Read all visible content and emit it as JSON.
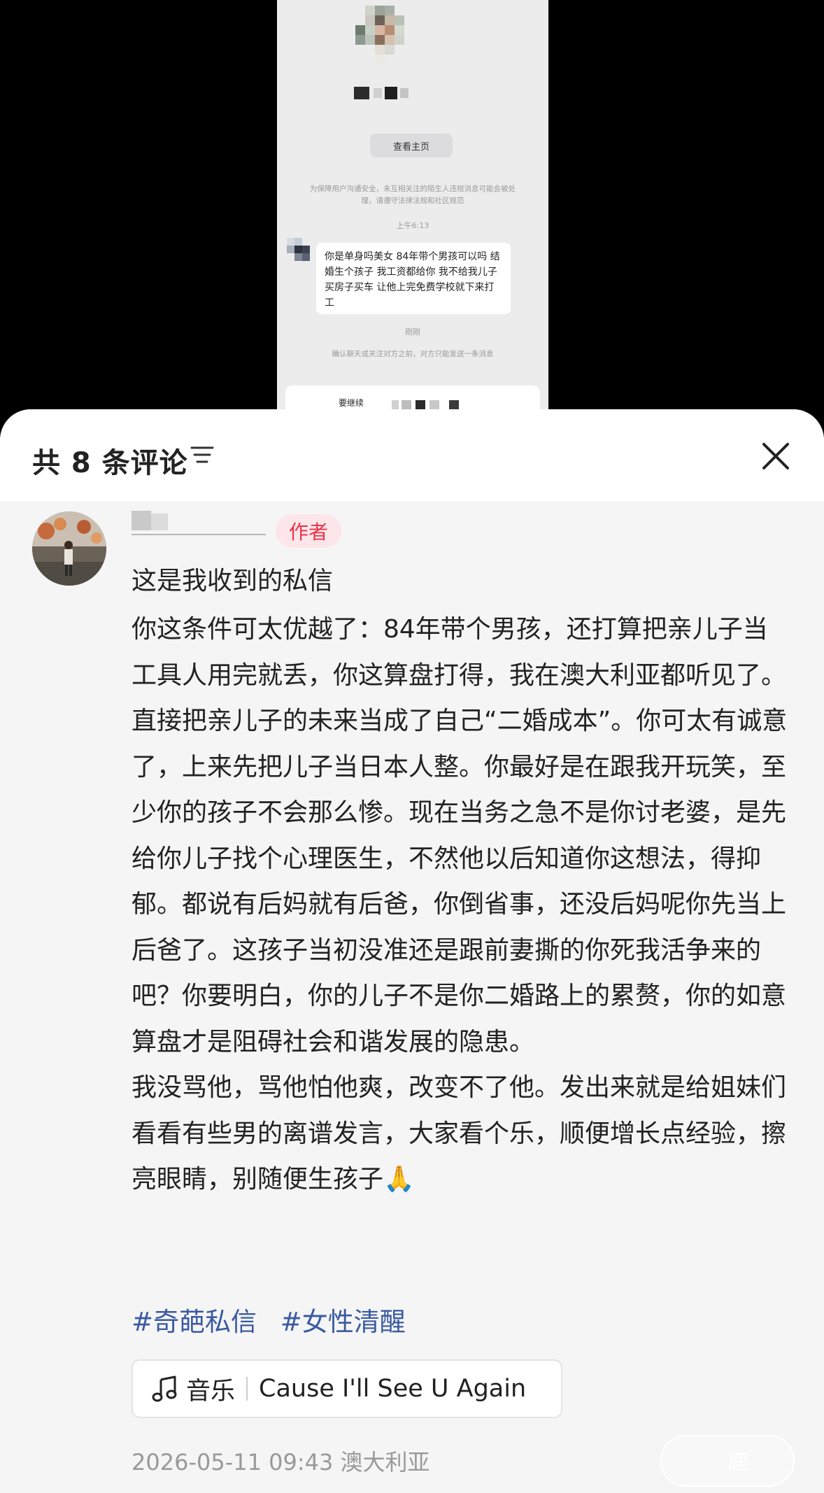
{
  "chat": {
    "view_profile_button": "查看主页",
    "notice": "为保障用户沟通安全，未互相关注的陌生人违规消息可能会被处理，请遵守法律法规和社区规范",
    "time": "上午6:13",
    "message": "你是单身吗美女 84年带个男孩可以吗 结婚生个孩子 我工资都给你 我不给我儿子买房子买车 让他上完免费学校就下来打工",
    "status_time": "刚刚",
    "follow_notice": "确认聊天或关注对方之前，对方只能发送一条消息",
    "continue_label": "要继续"
  },
  "header": {
    "comment_count": "共 8 条评论"
  },
  "comment": {
    "author_badge": "作者",
    "title": "这是我收到的私信",
    "paragraphs": [
      "你这条件可太优越了：84年带个男孩，还打算把亲儿子当工具人用完就丢，你这算盘打得，我在澳大利亚都听见了。直接把亲儿子的未来当成了自己“二婚成本”。你可太有诚意了，上来先把儿子当日本人整。你最好是在跟我开玩笑，至少你的孩子不会那么惨。现在当务之急不是你讨老婆，是先给你儿子找个心理医生，不然他以后知道你这想法，得抑郁。都说有后妈就有后爸，你倒省事，还没后妈呢你先当上后爸了。这孩子当初没准还是跟前妻撕的你死我活争来的吧？你要明白，你的儿子不是你二婚路上的累赘，你的如意算盘才是阻碍社会和谐发展的隐患。",
      "我没骂他，骂他怕他爽，改变不了他。发出来就是给姐妹们看看有些男的离谱发言，大家看个乐，顺便增长点经验，擦亮眼睛，别随便生孩子🙏"
    ],
    "tags": [
      "#奇葩私信",
      "#女性清醒"
    ],
    "music_label": "音乐",
    "song": "Cause I'll See U Again",
    "datetime": "2026-05-11 09:43",
    "location": "澳大利亚"
  },
  "watermark": "鹿",
  "colors": {
    "tag": "#3a5aa0",
    "author_badge_bg": "#fde6e9",
    "author_badge_text": "#e8344a"
  },
  "icons": [
    "sort-icon",
    "close-icon",
    "music-note-icon"
  ]
}
